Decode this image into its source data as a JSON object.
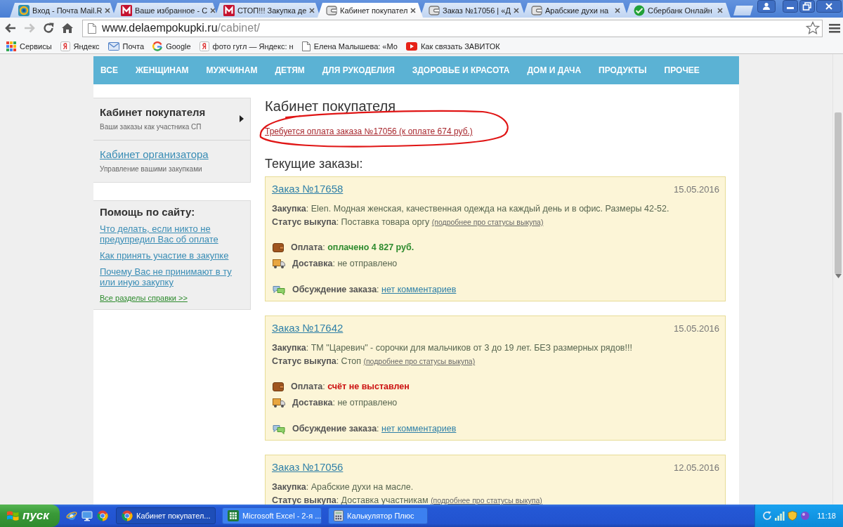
{
  "browser": {
    "tabs": [
      {
        "title": "Вход - Почта Mail.R",
        "kind": "target",
        "selected": false
      },
      {
        "title": "Ваше избранное - С",
        "kind": "letter",
        "selected": false
      },
      {
        "title": "СТОП!!! Закупка де",
        "kind": "letter",
        "selected": false
      },
      {
        "title": "Кабинет покупател",
        "kind": "wallet",
        "selected": true
      },
      {
        "title": "Заказ №17056 | «Д",
        "kind": "wallet",
        "selected": false
      },
      {
        "title": "Арабские духи на",
        "kind": "wallet",
        "selected": false
      },
      {
        "title": "Сбербанк Онлайн",
        "kind": "leaf",
        "selected": false
      }
    ],
    "address": {
      "domain": "www.delaempokupki.ru",
      "path": "/cabinet/"
    },
    "bookmarks": [
      {
        "label": "Сервисы",
        "kind": "apps"
      },
      {
        "label": "Яндекс",
        "kind": "yandex"
      },
      {
        "label": "Почта",
        "kind": "mail"
      },
      {
        "label": "Google",
        "kind": "google"
      },
      {
        "label": "фото гугл — Яндекс: н",
        "kind": "yandex"
      },
      {
        "label": "Елена Малышева: «Мо",
        "kind": "page"
      },
      {
        "label": "Как связать ЗАВИТОК",
        "kind": "youtube"
      }
    ]
  },
  "site_nav": [
    "ВСЕ",
    "ЖЕНЩИНАМ",
    "МУЖЧИНАМ",
    "ДЕТЯМ",
    "ДЛЯ РУКОДЕЛИЯ",
    "ЗДОРОВЬЕ И КРАСОТА",
    "ДОМ И ДАЧА",
    "ПРОДУКТЫ",
    "ПРОЧЕЕ"
  ],
  "sidebar": {
    "cabinets": [
      {
        "title": "Кабинет покупателя",
        "subtitle": "Ваши заказы как участника СП",
        "selected": true
      },
      {
        "title": "Кабинет организатора",
        "subtitle": "Управление вашими закупками",
        "selected": false
      }
    ],
    "help": {
      "title": "Помощь по сайту:",
      "links": [
        "Что делать, если никто не предупредил Вас об оплате",
        "Как принять участие в закупке",
        "Почему Вас не принимают в ту или иную закупку"
      ],
      "all_link": "Все разделы справки >>"
    }
  },
  "main": {
    "title": "Кабинет покупателя",
    "payment_notice": "Требуется оплата заказа №17056 (к оплате 674 руб.)",
    "section_title": "Текущие заказы:",
    "orders": [
      {
        "title": "Заказ №17658",
        "date": "15.05.2016",
        "purchase": "**Закупка**: Elen. Модная женская, качественная одежда на каждый день и в офис. Размеры 42-52.",
        "status": "**Статус выкупа**: Поставка товара оргу",
        "status_link": "(подробнее про статусы выкупа)",
        "payment_label": "**Оплата**:",
        "payment": "оплачено 4 827 руб.",
        "paid": true,
        "delivery": "**Доставка**: не отправлено",
        "discussion_label": "**Обсуждение заказа**:",
        "discussion": "нет комментариев"
      },
      {
        "title": "Заказ №17642",
        "date": "15.05.2016",
        "purchase": "**Закупка**: ТМ \"Царевич\" - сорочки для мальчиков от 3 до 19 лет. БЕЗ размерных рядов!!!",
        "status": "**Статус выкупа**: Стоп",
        "status_link": "(подробнее про статусы выкупа)",
        "payment_label": "**Оплата**:",
        "payment": "счёт не выставлен",
        "paid": false,
        "delivery": "**Доставка**: не отправлено",
        "discussion_label": "**Обсуждение заказа**:",
        "discussion": "нет комментариев"
      },
      {
        "title": "Заказ №17056",
        "date": "12.05.2016",
        "purchase": "**Закупка**: Арабские духи на масле.",
        "status": "**Статус выкупа**: Доставка участникам",
        "status_link": "(подробнее про статусы выкупа)"
      }
    ]
  },
  "taskbar": {
    "start": "пуск",
    "windows": [
      {
        "title": "Кабинет покупател...",
        "kind": "chrome",
        "selected": true
      },
      {
        "title": "Microsoft Excel - 2-я ...",
        "kind": "excel",
        "selected": false
      },
      {
        "title": "Калькулятор Плюс",
        "kind": "calc",
        "selected": false
      }
    ],
    "clock": "11:18"
  }
}
